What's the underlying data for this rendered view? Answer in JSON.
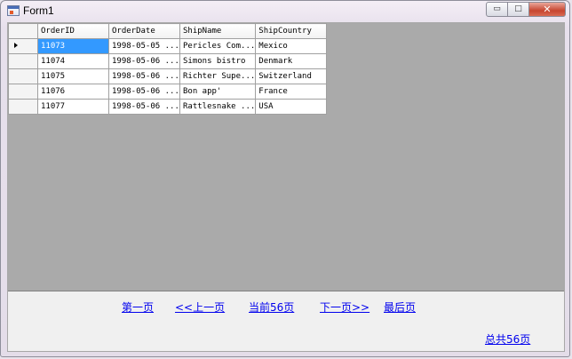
{
  "window": {
    "title": "Form1",
    "buttons": {
      "minimize": "▭",
      "maximize": "□",
      "close": "✕"
    }
  },
  "grid": {
    "columns": [
      "OrderID",
      "OrderDate",
      "ShipName",
      "ShipCountry"
    ],
    "rows": [
      [
        "11073",
        "1998-05-05 ...",
        "Pericles Com...",
        "Mexico"
      ],
      [
        "11074",
        "1998-05-06 ...",
        "Simons bistro",
        "Denmark"
      ],
      [
        "11075",
        "1998-05-06 ...",
        "Richter Supe...",
        "Switzerland"
      ],
      [
        "11076",
        "1998-05-06 ...",
        "Bon app'",
        "France"
      ],
      [
        "11077",
        "1998-05-06 ...",
        "Rattlesnake ...",
        "USA"
      ]
    ],
    "selected_row": 0
  },
  "pager": {
    "first": "第一页",
    "prev": "<<上一页",
    "current": "当前56页",
    "next": "下一页>>",
    "last": "最后页",
    "total": "总共56页"
  }
}
